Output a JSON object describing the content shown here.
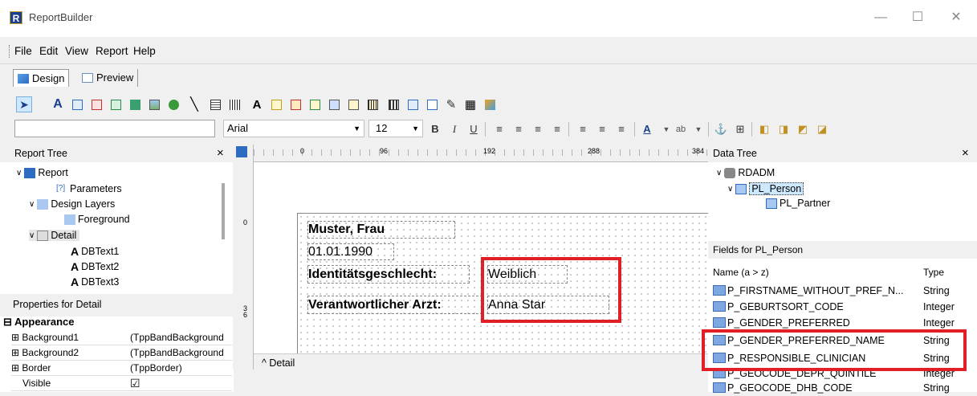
{
  "window": {
    "title": "ReportBuilder",
    "icon_letter": "R"
  },
  "menu": [
    "File",
    "Edit",
    "View",
    "Report",
    "Help"
  ],
  "tabs": [
    {
      "label": "Design"
    },
    {
      "label": "Preview"
    }
  ],
  "format_bar": {
    "font": "Arial",
    "size": "12"
  },
  "report_tree": {
    "title": "Report Tree",
    "close": "×",
    "items": [
      "Report",
      "Parameters",
      "Design Layers",
      "Foreground",
      "Detail",
      "DBText1",
      "DBText2",
      "DBText3"
    ]
  },
  "properties": {
    "title": "Properties for Detail",
    "section": "Appearance",
    "rows": [
      {
        "name": "Background1",
        "value": "(TppBandBackground"
      },
      {
        "name": "Background2",
        "value": "(TppBandBackground"
      },
      {
        "name": "Border",
        "value": "(TppBorder)"
      },
      {
        "name": "Visible",
        "value": "☑"
      }
    ]
  },
  "ruler": {
    "h_marks": [
      "0",
      "96",
      "192",
      "288",
      "384"
    ],
    "v_marks": [
      "0",
      "3\n6"
    ]
  },
  "canvas": {
    "texts": [
      "Muster, Frau",
      "01.01.1990",
      "Identitätsgeschlecht:",
      "Weiblich",
      "Verantwortlicher Arzt:",
      "Anna Star"
    ],
    "band_label": "^ Detail"
  },
  "data_tree": {
    "title": "Data Tree",
    "close": "×",
    "items": [
      "RDADM",
      "PL_Person",
      "PL_Partner"
    ]
  },
  "fields": {
    "title": "Fields for PL_Person",
    "col_name": "Name (a > z)",
    "col_type": "Type",
    "rows": [
      {
        "name": "P_FIRSTNAME_WITHOUT_PREF_N...",
        "type": "String"
      },
      {
        "name": "P_GEBURTSORT_CODE",
        "type": "Integer"
      },
      {
        "name": "P_GENDER_PREFERRED",
        "type": "Integer"
      },
      {
        "name": "P_GENDER_PREFERRED_NAME",
        "type": "String"
      },
      {
        "name": "P_RESPONSIBLE_CLINICIAN",
        "type": "String"
      },
      {
        "name": "P_GEOCODE_DEPR_QUINTILE",
        "type": "Integer"
      },
      {
        "name": "P_GEOCODE_DHB_CODE",
        "type": "String"
      }
    ]
  },
  "colors": {
    "highlight": "#e01f26",
    "selection": "#cde8ff"
  }
}
